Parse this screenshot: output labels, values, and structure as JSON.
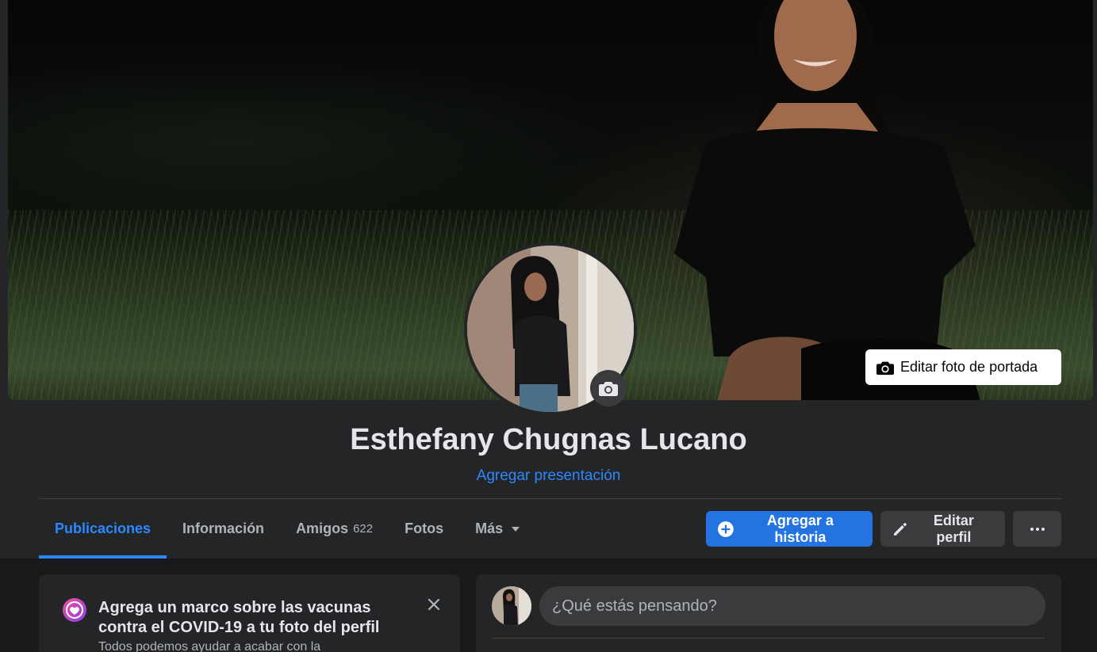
{
  "cover": {
    "edit_cover_label": "Editar foto de portada"
  },
  "profile": {
    "name": "Esthefany Chugnas Lucano",
    "add_bio": "Agregar presentación"
  },
  "tabs": [
    {
      "label": "Publicaciones",
      "active": true
    },
    {
      "label": "Información"
    },
    {
      "label": "Amigos",
      "count": "622"
    },
    {
      "label": "Fotos"
    },
    {
      "label": "Más"
    }
  ],
  "actions": {
    "add_story": "Agregar a historia",
    "edit_profile": "Editar perfil"
  },
  "covid_card": {
    "title": "Agrega un marco sobre las vacunas contra el COVID-19 a tu foto del perfil",
    "body": "Todos podemos ayudar a acabar con la"
  },
  "composer": {
    "placeholder": "¿Qué estás pensando?"
  },
  "colors": {
    "accent": "#2d88ff",
    "primary_button": "#2374e1",
    "surface": "#242526",
    "background": "#18191a"
  }
}
